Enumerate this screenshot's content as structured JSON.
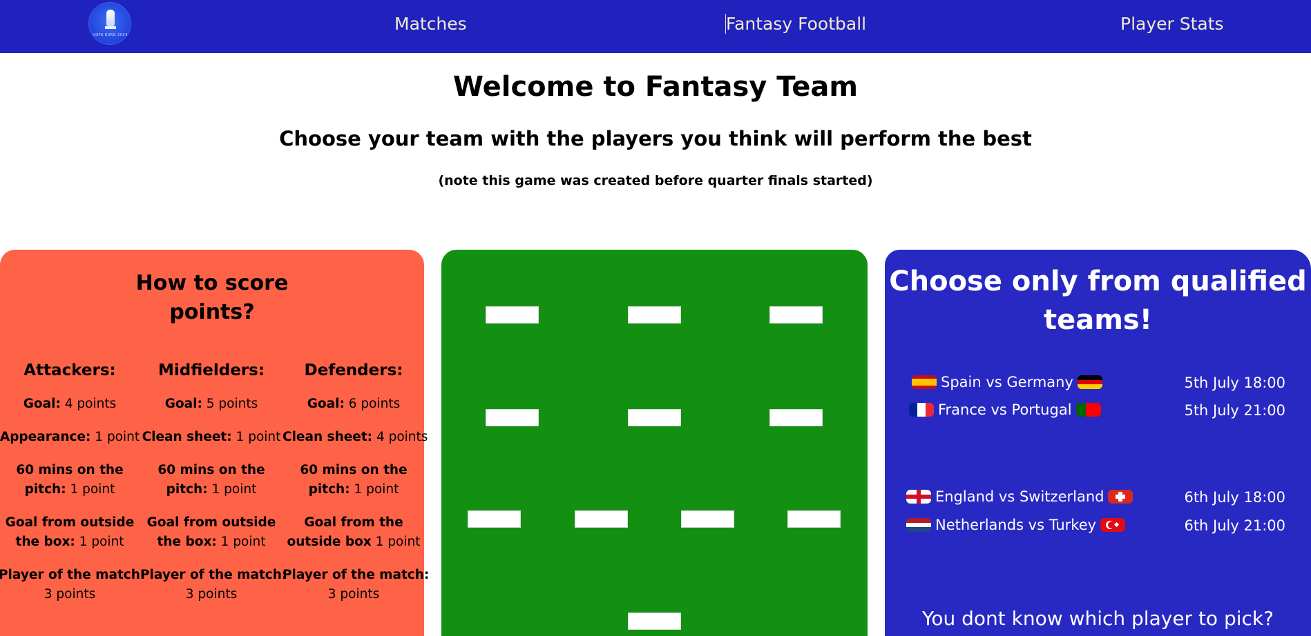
{
  "nav": {
    "logo_text": "UEFA EURO 2024",
    "links": [
      "Matches",
      "Fantasy Football",
      "Player Stats"
    ]
  },
  "header": {
    "title": "Welcome to Fantasy Team",
    "subtitle": "Choose your team with the players you think will perform the best",
    "note": "(note this game was created before quarter finals started)"
  },
  "scoring": {
    "title_line1": "How to score",
    "title_line2": "points?",
    "columns": [
      {
        "heading": "Attackers:",
        "rules": [
          {
            "b": "Goal:",
            "t": " 4 points"
          },
          {
            "b": "Appearance:",
            "t": " 1 point"
          },
          {
            "b": "60 mins on the",
            "b2": "pitch:",
            "t": " 1 point"
          },
          {
            "b": "Goal from outside",
            "b2": "the box:",
            "t": " 1 point"
          },
          {
            "b": "Player of the match:",
            "t2": "3 points"
          }
        ]
      },
      {
        "heading": "Midfielders:",
        "rules": [
          {
            "b": "Goal:",
            "t": " 5 points"
          },
          {
            "b": "Clean sheet:",
            "t": " 1 point"
          },
          {
            "b": "60 mins on the",
            "b2": "pitch:",
            "t": " 1 point"
          },
          {
            "b": "Goal from outside",
            "b2": "the box:",
            "t": " 1 point"
          },
          {
            "b": "Player of the match:",
            "t2": "3 points"
          }
        ]
      },
      {
        "heading": "Defenders:",
        "rules": [
          {
            "b": "Goal:",
            "t": "  6 points"
          },
          {
            "b": "Clean sheet:",
            "t": " 4 points"
          },
          {
            "b": "60 mins on the",
            "b2": "pitch:",
            "t": " 1 point"
          },
          {
            "b": "Goal from the",
            "b2": "outside box",
            "t": " 1 point"
          },
          {
            "b": "Player of the match:",
            "t2": "3 points"
          }
        ]
      }
    ]
  },
  "pitch": {
    "slots": [
      {
        "name": "slot-forward-left",
        "value": ""
      },
      {
        "name": "slot-forward-center",
        "value": ""
      },
      {
        "name": "slot-forward-right",
        "value": ""
      },
      {
        "name": "slot-midfield-left",
        "value": ""
      },
      {
        "name": "slot-midfield-center",
        "value": ""
      },
      {
        "name": "slot-midfield-right",
        "value": ""
      },
      {
        "name": "slot-defender-1",
        "value": ""
      },
      {
        "name": "slot-defender-2",
        "value": ""
      },
      {
        "name": "slot-defender-3",
        "value": ""
      },
      {
        "name": "slot-defender-4",
        "value": ""
      },
      {
        "name": "slot-goalkeeper",
        "value": ""
      }
    ]
  },
  "qualified": {
    "title_line1": "Choose only from qualified",
    "title_line2": "teams!",
    "matches": [
      {
        "label": "Spain vs Germany",
        "time": "5th July 18:00",
        "flag1": "spain-flag-icon",
        "flag2": "germany-flag-icon"
      },
      {
        "label": "France vs Portugal",
        "time": "5th July 21:00",
        "flag1": "france-flag-icon",
        "flag2": "portugal-flag-icon"
      },
      {
        "label": "England vs Switzerland",
        "time": "6th July 18:00",
        "flag1": "england-flag-icon",
        "flag2": "switzerland-flag-icon"
      },
      {
        "label": "Netherlands vs Turkey",
        "time": "6th July 21:00",
        "flag1": "netherlands-flag-icon",
        "flag2": "turkey-flag-icon"
      }
    ],
    "bottom_text": "You dont know which player to pick?"
  },
  "colors": {
    "navbar": "#1f22bd",
    "score_panel": "#fe6347",
    "pitch_panel": "#138f12",
    "teams_panel": "#2828c3"
  }
}
